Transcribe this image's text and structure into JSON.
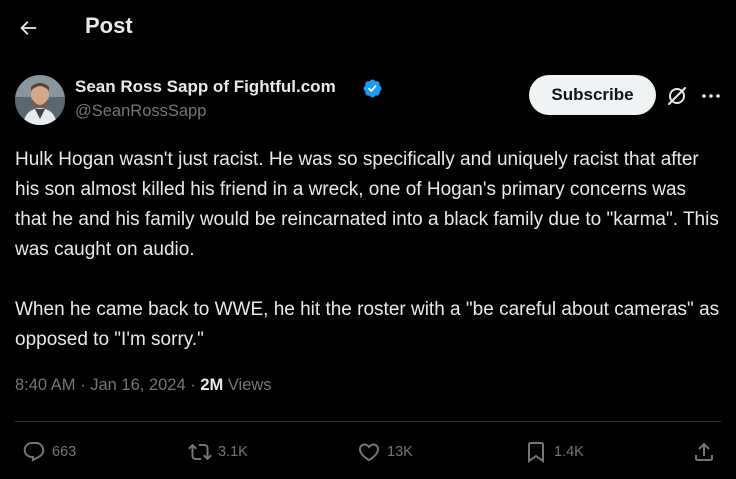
{
  "header": {
    "title": "Post"
  },
  "author": {
    "name": "Sean Ross Sapp of Fightful.com",
    "handle": "@SeanRossSapp",
    "verified": true
  },
  "buttons": {
    "subscribe_label": "Subscribe"
  },
  "icons": {
    "back": "arrow-left-icon",
    "verified": "verified-badge-icon",
    "grok": "grok-icon",
    "more": "more-icon",
    "reply": "reply-icon",
    "repost": "repost-icon",
    "like": "heart-icon",
    "bookmark": "bookmark-icon",
    "share": "share-icon"
  },
  "tweet": {
    "paragraph1": "Hulk Hogan wasn't just racist. He was so specifically and uniquely racist that after his son almost killed his friend in a wreck, one of Hogan's primary concerns was that he and his family would be reincarnated into a black family due to \"karma\". This was caught on audio.",
    "paragraph2": "When he came back to WWE, he hit the roster with a \"be careful about cameras\" as opposed to \"I'm sorry.\""
  },
  "meta": {
    "time": "8:40 AM",
    "separator": " · ",
    "date": "Jan 16, 2024",
    "views_count": "2M",
    "views_label": " Views"
  },
  "actions": {
    "replies": "663",
    "reposts": "3.1K",
    "likes": "13K",
    "bookmarks": "1.4K"
  },
  "colors": {
    "background": "#000000",
    "text": "#e7e9ea",
    "secondary": "#71767b",
    "verified": "#1d9bf0",
    "divider": "#2f3336"
  }
}
